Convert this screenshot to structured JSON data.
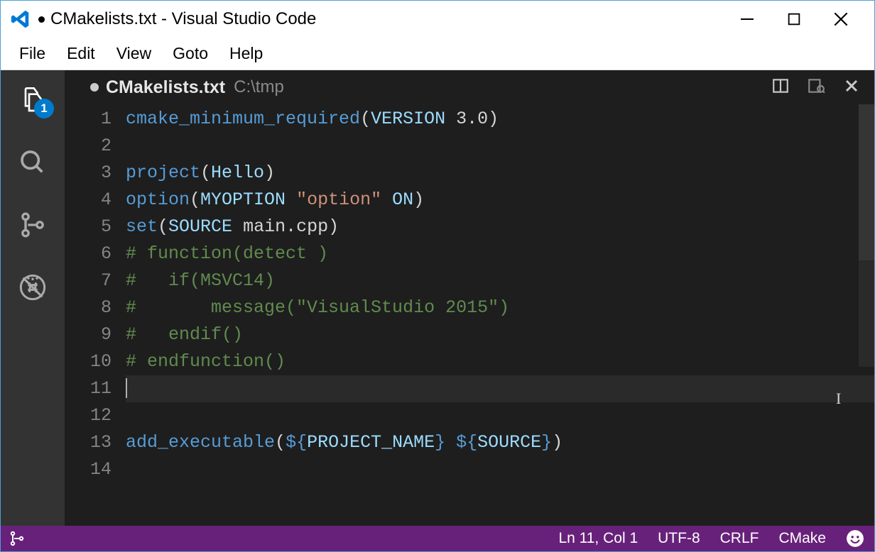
{
  "window": {
    "title": "CMakelists.txt - Visual Studio Code",
    "dirty": true
  },
  "menu": [
    "File",
    "Edit",
    "View",
    "Goto",
    "Help"
  ],
  "activity": {
    "explorer_badge": "1"
  },
  "tab": {
    "name": "CMakelists.txt",
    "path": "C:\\tmp",
    "dirty": true
  },
  "editor": {
    "line_count": 14,
    "current_line": 11,
    "lines": [
      {
        "n": 1,
        "tokens": [
          [
            "fn",
            "cmake_minimum_required"
          ],
          [
            "paren",
            "("
          ],
          [
            "id",
            "VERSION"
          ],
          [
            "plain",
            " "
          ],
          [
            "num",
            "3.0"
          ],
          [
            "paren",
            ")"
          ]
        ]
      },
      {
        "n": 2,
        "tokens": []
      },
      {
        "n": 3,
        "tokens": [
          [
            "fn",
            "project"
          ],
          [
            "paren",
            "("
          ],
          [
            "id",
            "Hello"
          ],
          [
            "paren",
            ")"
          ]
        ]
      },
      {
        "n": 4,
        "tokens": [
          [
            "fn",
            "option"
          ],
          [
            "paren",
            "("
          ],
          [
            "id",
            "MYOPTION"
          ],
          [
            "plain",
            " "
          ],
          [
            "str",
            "\"option\""
          ],
          [
            "plain",
            " "
          ],
          [
            "id",
            "ON"
          ],
          [
            "paren",
            ")"
          ]
        ]
      },
      {
        "n": 5,
        "tokens": [
          [
            "fn",
            "set"
          ],
          [
            "paren",
            "("
          ],
          [
            "id",
            "SOURCE"
          ],
          [
            "plain",
            " "
          ],
          [
            "plain",
            "main.cpp"
          ],
          [
            "paren",
            ")"
          ]
        ]
      },
      {
        "n": 6,
        "tokens": [
          [
            "cmt",
            "# function(detect )"
          ]
        ]
      },
      {
        "n": 7,
        "tokens": [
          [
            "cmt",
            "#   if(MSVC14)"
          ]
        ]
      },
      {
        "n": 8,
        "tokens": [
          [
            "cmt",
            "#       message(\"VisualStudio 2015\")"
          ]
        ]
      },
      {
        "n": 9,
        "tokens": [
          [
            "cmt",
            "#   endif()"
          ]
        ]
      },
      {
        "n": 10,
        "tokens": [
          [
            "cmt",
            "# endfunction()"
          ]
        ]
      },
      {
        "n": 11,
        "tokens": []
      },
      {
        "n": 12,
        "tokens": []
      },
      {
        "n": 13,
        "tokens": [
          [
            "fn",
            "add_executable"
          ],
          [
            "paren",
            "("
          ],
          [
            "var",
            "${"
          ],
          [
            "id",
            "PROJECT_NAME"
          ],
          [
            "var",
            "}"
          ],
          [
            "plain",
            " "
          ],
          [
            "var",
            "${"
          ],
          [
            "id",
            "SOURCE"
          ],
          [
            "var",
            "}"
          ],
          [
            "paren",
            ")"
          ]
        ]
      },
      {
        "n": 14,
        "tokens": []
      }
    ]
  },
  "status": {
    "position": "Ln 11, Col 1",
    "encoding": "UTF-8",
    "eol": "CRLF",
    "language": "CMake"
  }
}
